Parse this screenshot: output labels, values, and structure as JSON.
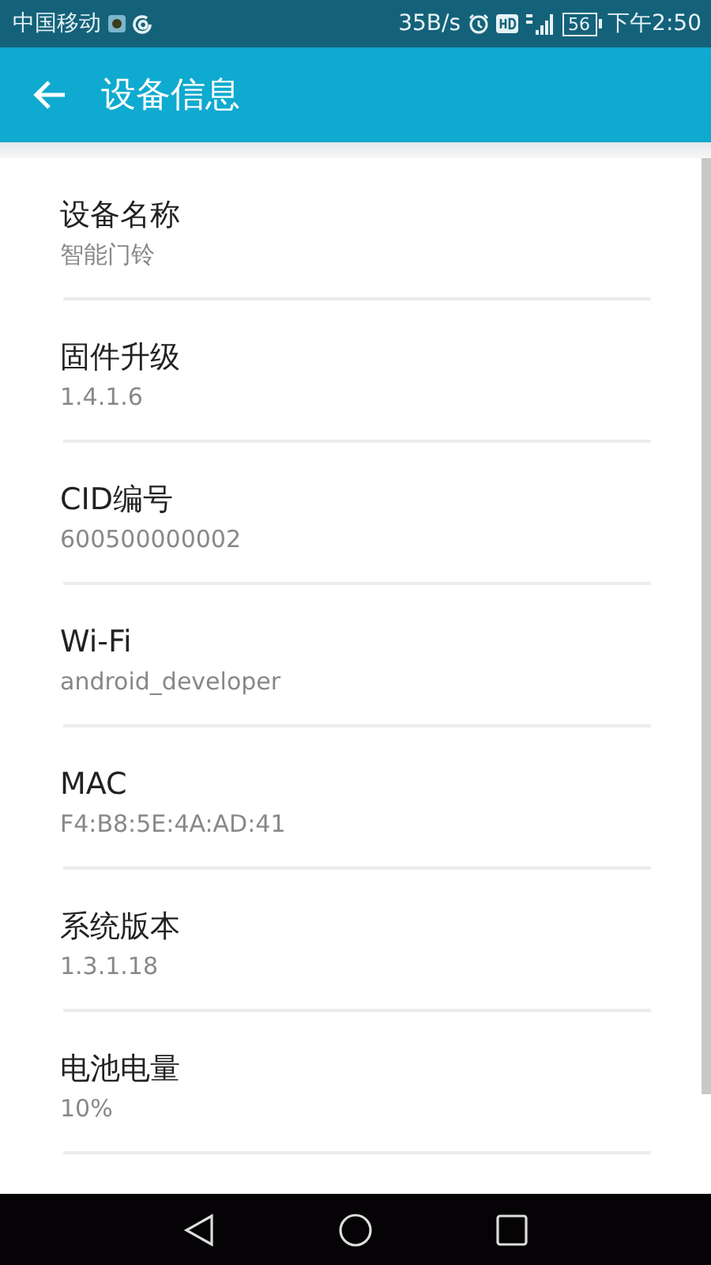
{
  "status_bar": {
    "carrier": "中国移动",
    "network_speed": "35B/s",
    "battery": "56",
    "time": "下午2:50"
  },
  "app_bar": {
    "title": "设备信息"
  },
  "items": [
    {
      "label": "设备名称",
      "value": "智能门铃"
    },
    {
      "label": "固件升级",
      "value": "1.4.1.6"
    },
    {
      "label": "CID编号",
      "value": "600500000002"
    },
    {
      "label": "Wi-Fi",
      "value": "android_developer"
    },
    {
      "label": "MAC",
      "value": "F4:B8:5E:4A:AD:41"
    },
    {
      "label": "系统版本",
      "value": "1.3.1.18"
    },
    {
      "label": "电池电量",
      "value": "10%"
    }
  ]
}
